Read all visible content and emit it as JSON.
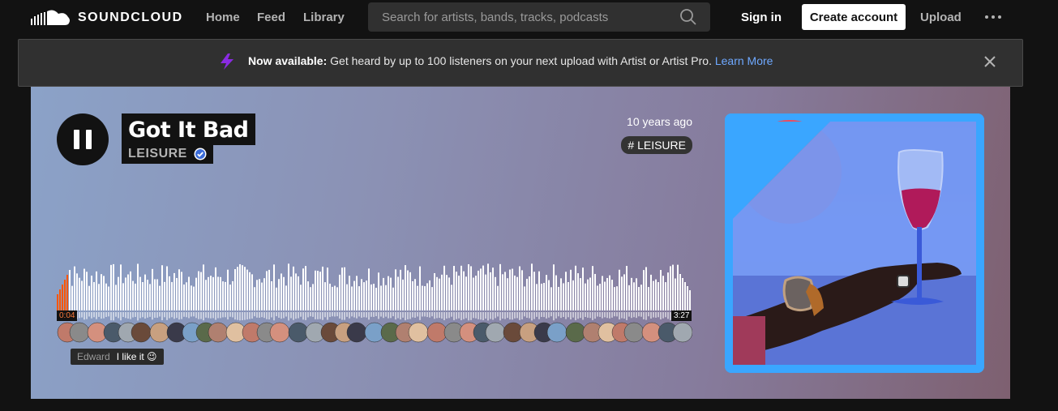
{
  "header": {
    "logo_text": "SOUNDCLOUD",
    "nav": [
      {
        "label": "Home"
      },
      {
        "label": "Feed"
      },
      {
        "label": "Library"
      }
    ],
    "search_placeholder": "Search for artists, bands, tracks, podcasts",
    "sign_in": "Sign in",
    "create_account": "Create account",
    "upload": "Upload"
  },
  "banner": {
    "bold": "Now available:",
    "text": " Get heard by up to 100 listeners on your next upload with Artist or Artist Pro. ",
    "link": "Learn More"
  },
  "track": {
    "title": "Got It Bad",
    "artist": "LEISURE",
    "posted": "10 years ago",
    "tag": "# LEISURE",
    "elapsed": "0:04",
    "duration": "3:27",
    "progress": 0.02
  },
  "comment": {
    "user": "Edward",
    "message": "I like it 😉"
  },
  "colors": {
    "accent": "#ff5500",
    "link": "#6ea8ff",
    "artwork_bg": "#3aa6ff"
  }
}
